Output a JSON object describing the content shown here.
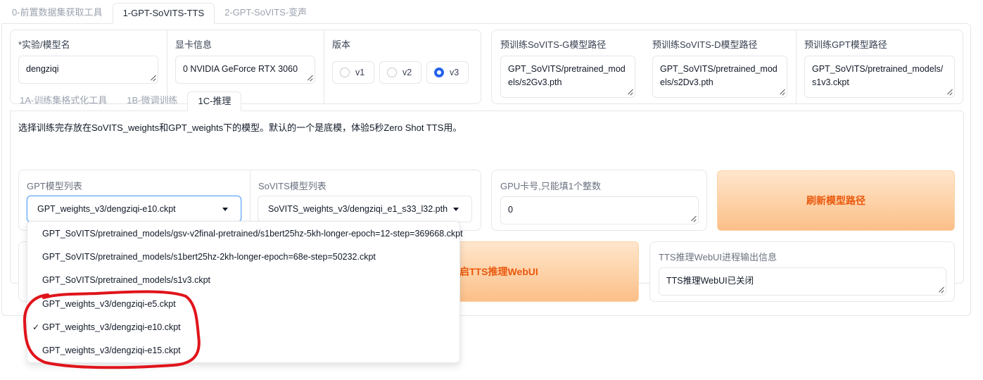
{
  "top_tabs": [
    "0-前置数据集获取工具",
    "1-GPT-SoVITS-TTS",
    "2-GPT-SoVITS-变声"
  ],
  "experiment": {
    "label": "*实验/模型名",
    "value": "dengziqi"
  },
  "gpu_info": {
    "label": "显卡信息",
    "value": "0 NVIDIA GeForce RTX 3060"
  },
  "version": {
    "label": "版本",
    "options": [
      "v1",
      "v2",
      "v3"
    ],
    "selected": "v3"
  },
  "pretrained": [
    {
      "label": "预训练SoVITS-G模型路径",
      "value": "GPT_SoVITS/pretrained_models/s2Gv3.pth"
    },
    {
      "label": "预训练SoVITS-D模型路径",
      "value": "GPT_SoVITS/pretrained_models/s2Dv3.pth"
    },
    {
      "label": "预训练GPT模型路径",
      "value": "GPT_SoVITS/pretrained_models/s1v3.ckpt"
    }
  ],
  "sub_tabs": [
    "1A-训练集格式化工具",
    "1B-微调训练",
    "1C-推理"
  ],
  "description": "选择训练完存放在SoVITS_weights和GPT_weights下的模型。默认的一个是底模，体验5秒Zero Shot TTS用。",
  "gpt_models": {
    "label": "GPT模型列表",
    "selected": "GPT_weights_v3/dengziqi-e10.ckpt",
    "options": [
      "GPT_SoVITS/pretrained_models/gsv-v2final-pretrained/s1bert25hz-5kh-longer-epoch=12-step=369668.ckpt",
      "GPT_SoVITS/pretrained_models/s1bert25hz-2kh-longer-epoch=68e-step=50232.ckpt",
      "GPT_SoVITS/pretrained_models/s1v3.ckpt",
      "GPT_weights_v3/dengziqi-e5.ckpt",
      "GPT_weights_v3/dengziqi-e10.ckpt",
      "GPT_weights_v3/dengziqi-e15.ckpt"
    ],
    "check_mark": "✓"
  },
  "sovits_models": {
    "label": "SoVITS模型列表",
    "selected": "SoVITS_weights_v3/dengziqi_e1_s33_l32.pth"
  },
  "gpu_index": {
    "label": "GPU卡号,只能填1个整数",
    "value": "0"
  },
  "refresh_button": "刷新模型路径",
  "open_tts_button_visible": "启TTS推理WebUI",
  "tts_output": {
    "label": "TTS推理WebUI进程输出信息",
    "value": "TTS推理WebUI已关闭"
  },
  "colors": {
    "accent_blue": "#2563eb",
    "button_orange": "#ea580c",
    "annotation_red": "#e0141b"
  }
}
